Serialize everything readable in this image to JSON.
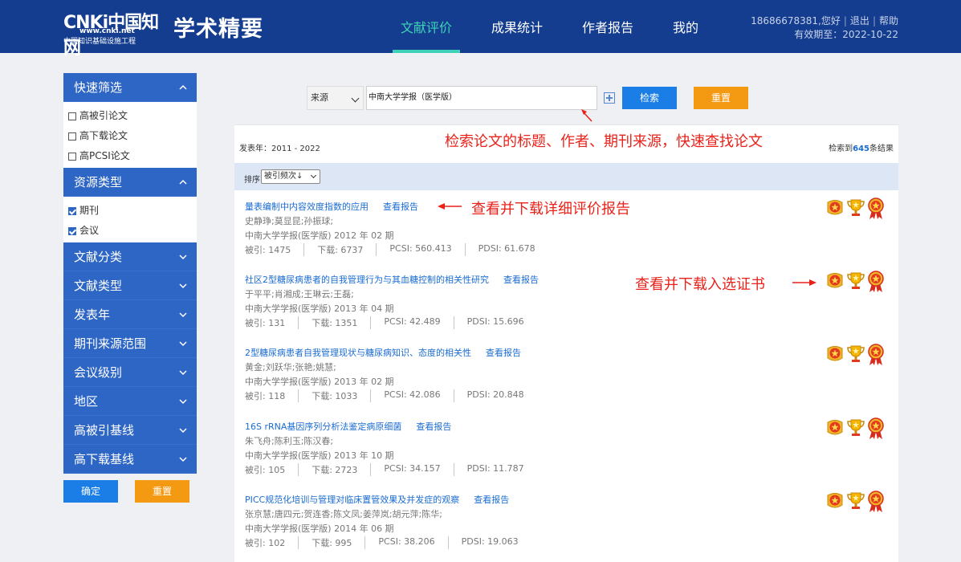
{
  "header": {
    "logo_text": "CNKi中国知网",
    "logo_url_text": "www.cnki.net",
    "logo_subtitle": "中国知识基础设施工程",
    "brand": "学术精要",
    "nav": [
      "文献评价",
      "成果统计",
      "作者报告",
      "我的"
    ],
    "active_nav": "文献评价",
    "user_greeting": "18686678381,您好",
    "logout": "退出",
    "help": "帮助",
    "expiry": "有效期至：2022-10-22"
  },
  "sidebar": {
    "quick_filter": "快速筛选",
    "quick_options": [
      {
        "label": "高被引论文",
        "checked": false
      },
      {
        "label": "高下载论文",
        "checked": false
      },
      {
        "label": "高PCSI论文",
        "checked": false
      }
    ],
    "resource_type": "资源类型",
    "resource_options": [
      {
        "label": "期刊",
        "checked": true
      },
      {
        "label": "会议",
        "checked": true
      }
    ],
    "collapsed_sections": [
      "文献分类",
      "文献类型",
      "发表年",
      "期刊来源范围",
      "会议级别",
      "地区",
      "高被引基线",
      "高下载基线"
    ],
    "confirm": "确定",
    "reset": "重置"
  },
  "search": {
    "field": "来源",
    "query": "中南大学学报（医学版）",
    "search_button": "检索",
    "reset_button": "重置"
  },
  "results": {
    "year_range": "发表年：2011 - 2022",
    "count_prefix": "检索到",
    "count": "645",
    "count_suffix": "条结果",
    "sort_label": "排序",
    "sort_value": "被引频次↓"
  },
  "annotations": {
    "search_tip": "检索论文的标题、作者、期刊来源，快速查找论文",
    "report_tip": "查看并下载详细评价报告",
    "cert_tip": "查看并下载入选证书"
  },
  "papers": [
    {
      "title": "量表编制中内容效度指数的应用",
      "report": "查看报告",
      "authors": "史静琤;莫显昆;孙振球;",
      "source": "中南大学学报(医学版) 2012 年 02 期",
      "cited": "被引: 1475",
      "downloads": "下载: 6737",
      "pcsi": "PCSI: 560.413",
      "pdsi": "PDSI: 61.678"
    },
    {
      "title": "社区2型糖尿病患者的自我管理行为与其血糖控制的相关性研究",
      "report": "查看报告",
      "authors": "于平平;肖湘成;王琳云;王磊;",
      "source": "中南大学学报(医学版) 2013 年 04 期",
      "cited": "被引: 131",
      "downloads": "下载: 1351",
      "pcsi": "PCSI: 42.489",
      "pdsi": "PDSI: 15.696"
    },
    {
      "title": "2型糖尿病患者自我管理现状与糖尿病知识、态度的相关性",
      "report": "查看报告",
      "authors": "黄金;刘跃华;张艳;姚慧;",
      "source": "中南大学学报(医学版) 2013 年 02 期",
      "cited": "被引: 118",
      "downloads": "下载: 1033",
      "pcsi": "PCSI: 42.086",
      "pdsi": "PDSI: 20.848"
    },
    {
      "title": "16S rRNA基因序列分析法鉴定病原细菌",
      "report": "查看报告",
      "authors": "朱飞舟;陈利玉;陈汉春;",
      "source": "中南大学学报(医学版) 2013 年 10 期",
      "cited": "被引: 105",
      "downloads": "下载: 2723",
      "pcsi": "PCSI: 34.157",
      "pdsi": "PDSI: 11.787"
    },
    {
      "title": "PICC规范化培训与管理对临床置管效果及并发症的观察",
      "report": "查看报告",
      "authors": "张京慧;唐四元;贺连香;陈文凤;姜萍岚;胡元萍;陈华;",
      "source": "中南大学学报(医学版) 2014 年 06 期",
      "cited": "被引: 102",
      "downloads": "下载: 995",
      "pcsi": "PCSI: 38.206",
      "pdsi": "PDSI: 19.063"
    }
  ],
  "colors": {
    "header_bg": "#143d8f",
    "accent": "#3fd2b8",
    "sidebar_blue": "#2e66c5",
    "button_blue": "#1a7ee6",
    "button_orange": "#f49a12",
    "annotation_red": "#e8221a",
    "link_blue": "#1a6cd2"
  },
  "icons": [
    "gold-medal-icon",
    "trophy-icon",
    "red-ribbon-medal-icon"
  ]
}
